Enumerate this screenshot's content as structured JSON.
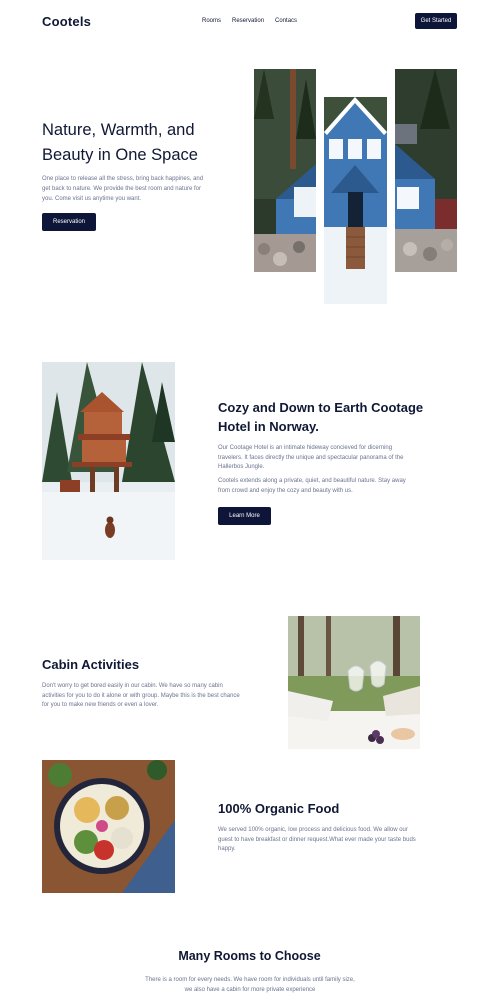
{
  "brand": {
    "name": "Cootels"
  },
  "nav": {
    "links": [
      "Rooms",
      "Reservation",
      "Contacs"
    ],
    "cta": "Get Started"
  },
  "hero": {
    "title": "Nature, Warmth, and Beauty in One Space",
    "text": "One place to release all the stress, bring back happines, and get back to nature. We provide the best room and nature for you. Come visit us anytime you want.",
    "button": "Reservation"
  },
  "about": {
    "title": "Cozy and Down to Earth Cootage Hotel in Norway.",
    "paragraph1": "Our Cootage Hotel is an intimate hideway concieved for dicerning travelers. It faces directly the unique and spectacular panorama of the Hallerbos Jungle.",
    "paragraph2": "Cootels extends along a private, quiet, and beautiful nature. Stay away from crowd and enjoy the cozy and beauty with us.",
    "button": "Learn More"
  },
  "activities": {
    "title": "Cabin Activities",
    "text": "Don't worry to get bored easily in our cabin. We have so many cabin activities for you to do it alone or with group. Maybe this is the best chance for you to make new friends or even a lover."
  },
  "food": {
    "title": "100% Organic Food",
    "text": "We served 100% organic, low process and delicious food. We allow our guest to have breakfast or dinner request.What ever made your taste buds happy."
  },
  "rooms": {
    "title": "Many Rooms to Choose",
    "text": "There is a room for every needs. We have room for individuals until family size, we also have a cabin for more private experience"
  },
  "colors": {
    "primary": "#0d1638",
    "heading": "#0f1834",
    "body_text": "#6b7390",
    "cabin_blue": "#3f78b4"
  }
}
